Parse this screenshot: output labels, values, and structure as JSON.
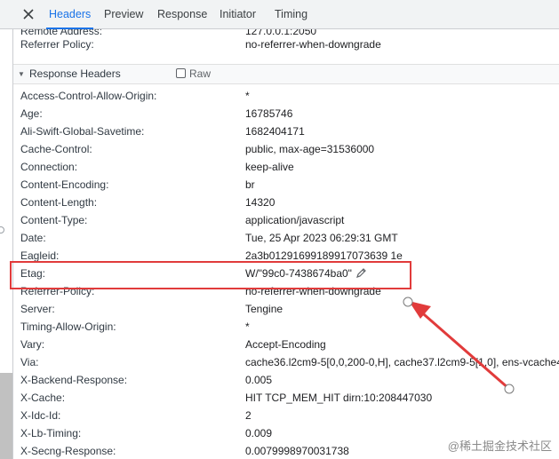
{
  "tabs": [
    {
      "label": "Headers",
      "active": true
    },
    {
      "label": "Preview",
      "active": false
    },
    {
      "label": "Response",
      "active": false
    },
    {
      "label": "Initiator",
      "active": false
    },
    {
      "label": "Timing",
      "active": false
    }
  ],
  "top_rows": [
    {
      "key": "Remote Address:",
      "value": "127.0.0.1:2050"
    },
    {
      "key": "Referrer Policy:",
      "value": "no-referrer-when-downgrade"
    }
  ],
  "response_headers": {
    "title": "Response Headers",
    "raw_label": "Raw",
    "raw_checked": false,
    "rows": [
      {
        "key": "Access-Control-Allow-Origin:",
        "value": "*"
      },
      {
        "key": "Age:",
        "value": "16785746"
      },
      {
        "key": "Ali-Swift-Global-Savetime:",
        "value": "1682404171"
      },
      {
        "key": "Cache-Control:",
        "value": "public, max-age=31536000"
      },
      {
        "key": "Connection:",
        "value": "keep-alive"
      },
      {
        "key": "Content-Encoding:",
        "value": "br"
      },
      {
        "key": "Content-Length:",
        "value": "14320"
      },
      {
        "key": "Content-Type:",
        "value": "application/javascript"
      },
      {
        "key": "Date:",
        "value": "Tue, 25 Apr 2023 06:29:31 GMT"
      },
      {
        "key": "Eagleid:",
        "value": "2a3b01291699189917073639 1e"
      },
      {
        "key": "Etag:",
        "value": "W/\"99c0-7438674ba0\"",
        "editable": true
      },
      {
        "key": "Referrer-Policy:",
        "value": "no-referrer-when-downgrade"
      },
      {
        "key": "Server:",
        "value": "Tengine"
      },
      {
        "key": "Timing-Allow-Origin:",
        "value": "*"
      },
      {
        "key": "Vary:",
        "value": "Accept-Encoding"
      },
      {
        "key": "Via:",
        "value": "cache36.l2cm9-5[0,0,200-0,H], cache37.l2cm9-5[1,0], ens-vcache49.c"
      },
      {
        "key": "X-Backend-Response:",
        "value": "0.005"
      },
      {
        "key": "X-Cache:",
        "value": "HIT TCP_MEM_HIT dirn:10:208447030"
      },
      {
        "key": "X-Idc-Id:",
        "value": "2"
      },
      {
        "key": "X-Lb-Timing:",
        "value": "0.009"
      },
      {
        "key": "X-Secng-Response:",
        "value": "0.0079998970031738"
      }
    ]
  },
  "annotation": {
    "color": "#e13b3b"
  },
  "watermark": "@稀土掘金技术社区"
}
